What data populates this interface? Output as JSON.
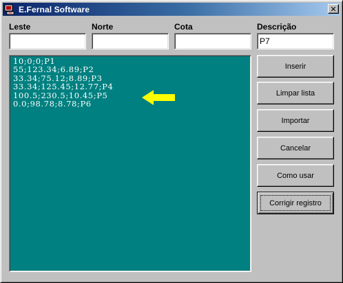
{
  "window": {
    "title": "E.Fernal Software",
    "close_glyph": "✕"
  },
  "fields": {
    "leste": {
      "label": "Leste",
      "value": ""
    },
    "norte": {
      "label": "Norte",
      "value": ""
    },
    "cota": {
      "label": "Cota",
      "value": ""
    },
    "descricao": {
      "label": "Descrição",
      "value": "P7"
    }
  },
  "list": {
    "background": "#008080",
    "items": [
      "10;0;0;P1",
      "55;123.34;6.89;P2",
      "33.34;75.12;8.89;P3",
      "33.34;125.45;12.77;P4",
      "100.5;230.5;10.45;P5",
      "0.0;98.78;8.78;P6"
    ],
    "highlight_indicator": {
      "icon": "arrow-left-icon",
      "color": "#ffff00"
    }
  },
  "buttons": {
    "inserir": "Inserir",
    "limpar": "Limpar lista",
    "importar": "Importar",
    "cancelar": "Cancelar",
    "como_usar": "Como usar",
    "corrigir": "Corrigir registro"
  }
}
